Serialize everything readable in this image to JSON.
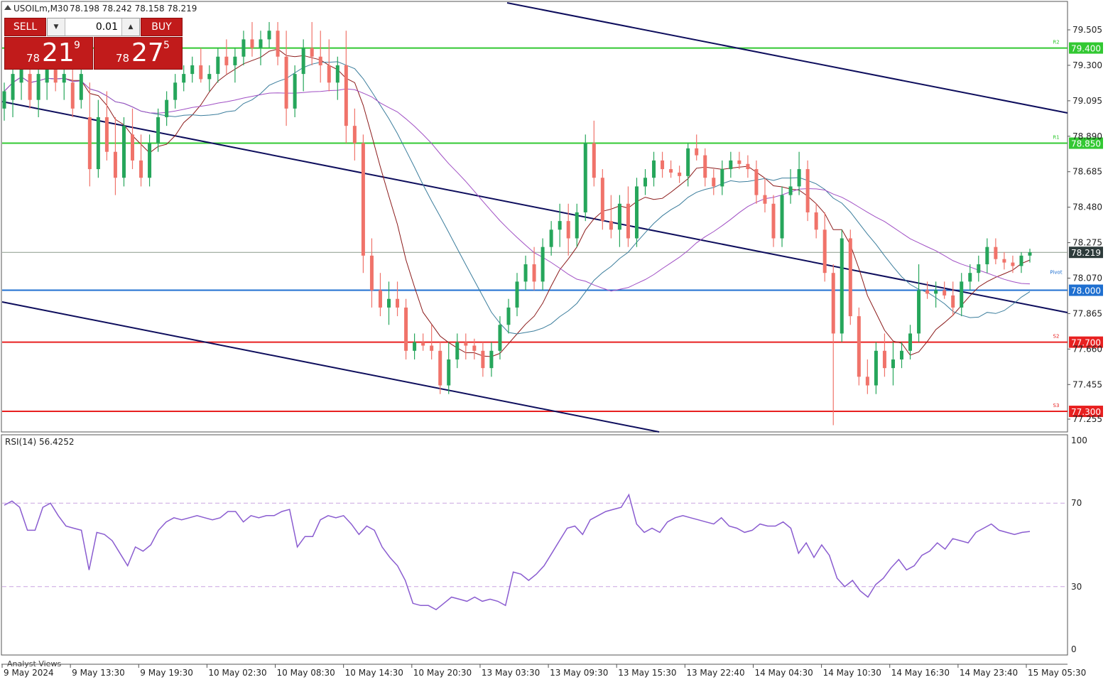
{
  "header": {
    "symbol_label": "USOILm,M30",
    "ohlc": "78.198 78.242 78.158 78.219",
    "collapse_icon": "triangle-up-icon"
  },
  "trade_panel": {
    "sell_label": "SELL",
    "buy_label": "BUY",
    "lot_value": "0.01",
    "sell_quote": {
      "prefix": "78",
      "big": "21",
      "sup": "9"
    },
    "buy_quote": {
      "prefix": "78",
      "big": "27",
      "sup": "5"
    }
  },
  "price_axis": {
    "ticks": [
      "79.505",
      "79.300",
      "79.095",
      "78.890",
      "78.685",
      "78.480",
      "78.275",
      "78.070",
      "77.865",
      "77.660",
      "77.455",
      "77.255"
    ],
    "current_price": "78.219"
  },
  "levels": [
    {
      "value": "79.400",
      "color": "#32c832",
      "tag": "R2"
    },
    {
      "value": "78.850",
      "color": "#32c832",
      "tag": "R1"
    },
    {
      "value": "78.000",
      "color": "#1e6fd0",
      "tag": "Pivot"
    },
    {
      "value": "77.700",
      "color": "#e82020",
      "tag": "S2"
    },
    {
      "value": "77.300",
      "color": "#e82020",
      "tag": "S3"
    }
  ],
  "rsi": {
    "label": "RSI(14) 56.4252",
    "ticks": [
      "100",
      "70",
      "30",
      "0"
    ]
  },
  "time_axis": [
    "9 May 2024",
    "9 May 13:30",
    "9 May 19:30",
    "10 May 02:30",
    "10 May 08:30",
    "10 May 14:30",
    "10 May 20:30",
    "13 May 03:30",
    "13 May 09:30",
    "13 May 15:30",
    "13 May 22:40",
    "14 May 04:30",
    "14 May 10:30",
    "14 May 16:30",
    "14 May 23:40",
    "15 May 05:30"
  ],
  "footer_label": "Analyst Views",
  "colors": {
    "bull": "#26a65b",
    "bear": "#f0736a",
    "ma_red": "#8b1a1a",
    "ma_teal": "#3b7d9c",
    "ma_purple": "#a04fc4",
    "channel": "#0d0d5c",
    "rsi": "#8a5cd0"
  },
  "chart_data": {
    "type": "candlestick",
    "symbol": "USOILm",
    "timeframe": "M30",
    "ylim": [
      77.2,
      79.62
    ],
    "candles": [
      {
        "o": 79.05,
        "h": 79.2,
        "l": 78.98,
        "c": 79.15
      },
      {
        "o": 79.1,
        "h": 79.3,
        "l": 79.0,
        "c": 79.25
      },
      {
        "o": 79.2,
        "h": 79.4,
        "l": 79.1,
        "c": 79.3
      },
      {
        "o": 79.25,
        "h": 79.35,
        "l": 79.05,
        "c": 79.1
      },
      {
        "o": 79.1,
        "h": 79.3,
        "l": 79.0,
        "c": 79.25
      },
      {
        "o": 79.2,
        "h": 79.35,
        "l": 79.1,
        "c": 79.3
      },
      {
        "o": 79.3,
        "h": 79.4,
        "l": 79.15,
        "c": 79.2
      },
      {
        "o": 79.2,
        "h": 79.3,
        "l": 79.1,
        "c": 79.25
      },
      {
        "o": 79.2,
        "h": 79.3,
        "l": 79.0,
        "c": 79.05
      },
      {
        "o": 79.1,
        "h": 79.3,
        "l": 79.05,
        "c": 79.25
      },
      {
        "o": 79.0,
        "h": 79.2,
        "l": 78.6,
        "c": 78.7
      },
      {
        "o": 78.7,
        "h": 79.1,
        "l": 78.65,
        "c": 79.0
      },
      {
        "o": 79.0,
        "h": 79.15,
        "l": 78.75,
        "c": 78.8
      },
      {
        "o": 78.8,
        "h": 79.0,
        "l": 78.55,
        "c": 78.65
      },
      {
        "o": 78.65,
        "h": 79.0,
        "l": 78.6,
        "c": 78.95
      },
      {
        "o": 78.9,
        "h": 79.05,
        "l": 78.7,
        "c": 78.75
      },
      {
        "o": 78.75,
        "h": 78.9,
        "l": 78.6,
        "c": 78.65
      },
      {
        "o": 78.65,
        "h": 78.9,
        "l": 78.6,
        "c": 78.85
      },
      {
        "o": 78.85,
        "h": 79.05,
        "l": 78.8,
        "c": 79.0
      },
      {
        "o": 79.0,
        "h": 79.15,
        "l": 78.95,
        "c": 79.1
      },
      {
        "o": 79.1,
        "h": 79.25,
        "l": 79.05,
        "c": 79.2
      },
      {
        "o": 79.2,
        "h": 79.3,
        "l": 79.15,
        "c": 79.25
      },
      {
        "o": 79.25,
        "h": 79.35,
        "l": 79.2,
        "c": 79.3
      },
      {
        "o": 79.3,
        "h": 79.4,
        "l": 79.2,
        "c": 79.22
      },
      {
        "o": 79.22,
        "h": 79.3,
        "l": 79.15,
        "c": 79.25
      },
      {
        "o": 79.25,
        "h": 79.4,
        "l": 79.2,
        "c": 79.35
      },
      {
        "o": 79.35,
        "h": 79.45,
        "l": 79.25,
        "c": 79.3
      },
      {
        "o": 79.3,
        "h": 79.4,
        "l": 79.2,
        "c": 79.35
      },
      {
        "o": 79.35,
        "h": 79.5,
        "l": 79.3,
        "c": 79.45
      },
      {
        "o": 79.45,
        "h": 79.55,
        "l": 79.35,
        "c": 79.4
      },
      {
        "o": 79.4,
        "h": 79.5,
        "l": 79.3,
        "c": 79.45
      },
      {
        "o": 79.45,
        "h": 79.55,
        "l": 79.4,
        "c": 79.5
      },
      {
        "o": 79.5,
        "h": 79.55,
        "l": 79.3,
        "c": 79.35
      },
      {
        "o": 79.35,
        "h": 79.5,
        "l": 78.95,
        "c": 79.05
      },
      {
        "o": 79.05,
        "h": 79.3,
        "l": 79.0,
        "c": 79.25
      },
      {
        "o": 79.25,
        "h": 79.45,
        "l": 79.15,
        "c": 79.4
      },
      {
        "o": 79.4,
        "h": 79.55,
        "l": 79.3,
        "c": 79.35
      },
      {
        "o": 79.35,
        "h": 79.5,
        "l": 79.2,
        "c": 79.3
      },
      {
        "o": 79.3,
        "h": 79.45,
        "l": 79.15,
        "c": 79.2
      },
      {
        "o": 79.2,
        "h": 79.35,
        "l": 79.1,
        "c": 79.3
      },
      {
        "o": 79.3,
        "h": 79.5,
        "l": 78.85,
        "c": 78.95
      },
      {
        "o": 78.95,
        "h": 79.05,
        "l": 78.75,
        "c": 78.85
      },
      {
        "o": 78.85,
        "h": 78.9,
        "l": 78.1,
        "c": 78.2
      },
      {
        "o": 78.2,
        "h": 78.3,
        "l": 77.9,
        "c": 78.0
      },
      {
        "o": 78.0,
        "h": 78.1,
        "l": 77.85,
        "c": 77.9
      },
      {
        "o": 77.9,
        "h": 78.05,
        "l": 77.8,
        "c": 77.95
      },
      {
        "o": 77.95,
        "h": 78.05,
        "l": 77.85,
        "c": 77.9
      },
      {
        "o": 77.9,
        "h": 77.95,
        "l": 77.6,
        "c": 77.65
      },
      {
        "o": 77.65,
        "h": 77.75,
        "l": 77.6,
        "c": 77.7
      },
      {
        "o": 77.7,
        "h": 77.75,
        "l": 77.65,
        "c": 77.68
      },
      {
        "o": 77.68,
        "h": 77.8,
        "l": 77.6,
        "c": 77.65
      },
      {
        "o": 77.65,
        "h": 77.7,
        "l": 77.4,
        "c": 77.45
      },
      {
        "o": 77.45,
        "h": 77.7,
        "l": 77.4,
        "c": 77.6
      },
      {
        "o": 77.6,
        "h": 77.75,
        "l": 77.55,
        "c": 77.7
      },
      {
        "o": 77.7,
        "h": 77.75,
        "l": 77.6,
        "c": 77.68
      },
      {
        "o": 77.68,
        "h": 77.72,
        "l": 77.6,
        "c": 77.65
      },
      {
        "o": 77.65,
        "h": 77.7,
        "l": 77.5,
        "c": 77.55
      },
      {
        "o": 77.55,
        "h": 77.7,
        "l": 77.5,
        "c": 77.65
      },
      {
        "o": 77.65,
        "h": 77.85,
        "l": 77.6,
        "c": 77.8
      },
      {
        "o": 77.8,
        "h": 77.95,
        "l": 77.75,
        "c": 77.9
      },
      {
        "o": 77.9,
        "h": 78.1,
        "l": 77.85,
        "c": 78.05
      },
      {
        "o": 78.05,
        "h": 78.2,
        "l": 78.0,
        "c": 78.15
      },
      {
        "o": 78.15,
        "h": 78.25,
        "l": 78.0,
        "c": 78.05
      },
      {
        "o": 78.05,
        "h": 78.3,
        "l": 78.0,
        "c": 78.25
      },
      {
        "o": 78.25,
        "h": 78.4,
        "l": 78.2,
        "c": 78.35
      },
      {
        "o": 78.35,
        "h": 78.5,
        "l": 78.25,
        "c": 78.4
      },
      {
        "o": 78.4,
        "h": 78.5,
        "l": 78.2,
        "c": 78.3
      },
      {
        "o": 78.3,
        "h": 78.5,
        "l": 78.25,
        "c": 78.45
      },
      {
        "o": 78.45,
        "h": 78.9,
        "l": 78.4,
        "c": 78.85
      },
      {
        "o": 78.85,
        "h": 78.98,
        "l": 78.6,
        "c": 78.65
      },
      {
        "o": 78.65,
        "h": 78.7,
        "l": 78.35,
        "c": 78.4
      },
      {
        "o": 78.4,
        "h": 78.55,
        "l": 78.3,
        "c": 78.35
      },
      {
        "o": 78.35,
        "h": 78.55,
        "l": 78.25,
        "c": 78.5
      },
      {
        "o": 78.5,
        "h": 78.6,
        "l": 78.25,
        "c": 78.3
      },
      {
        "o": 78.3,
        "h": 78.65,
        "l": 78.25,
        "c": 78.6
      },
      {
        "o": 78.6,
        "h": 78.7,
        "l": 78.55,
        "c": 78.65
      },
      {
        "o": 78.65,
        "h": 78.8,
        "l": 78.6,
        "c": 78.75
      },
      {
        "o": 78.75,
        "h": 78.8,
        "l": 78.65,
        "c": 78.7
      },
      {
        "o": 78.7,
        "h": 78.75,
        "l": 78.65,
        "c": 78.68
      },
      {
        "o": 78.68,
        "h": 78.72,
        "l": 78.62,
        "c": 78.66
      },
      {
        "o": 78.66,
        "h": 78.85,
        "l": 78.6,
        "c": 78.82
      },
      {
        "o": 78.82,
        "h": 78.9,
        "l": 78.75,
        "c": 78.78
      },
      {
        "o": 78.78,
        "h": 78.82,
        "l": 78.6,
        "c": 78.65
      },
      {
        "o": 78.65,
        "h": 78.7,
        "l": 78.55,
        "c": 78.6
      },
      {
        "o": 78.6,
        "h": 78.75,
        "l": 78.55,
        "c": 78.7
      },
      {
        "o": 78.7,
        "h": 78.8,
        "l": 78.65,
        "c": 78.75
      },
      {
        "o": 78.75,
        "h": 78.8,
        "l": 78.7,
        "c": 78.73
      },
      {
        "o": 78.73,
        "h": 78.78,
        "l": 78.65,
        "c": 78.7
      },
      {
        "o": 78.7,
        "h": 78.75,
        "l": 78.5,
        "c": 78.55
      },
      {
        "o": 78.55,
        "h": 78.65,
        "l": 78.45,
        "c": 78.5
      },
      {
        "o": 78.5,
        "h": 78.55,
        "l": 78.25,
        "c": 78.3
      },
      {
        "o": 78.3,
        "h": 78.6,
        "l": 78.25,
        "c": 78.55
      },
      {
        "o": 78.55,
        "h": 78.7,
        "l": 78.5,
        "c": 78.6
      },
      {
        "o": 78.6,
        "h": 78.8,
        "l": 78.55,
        "c": 78.7
      },
      {
        "o": 78.7,
        "h": 78.75,
        "l": 78.4,
        "c": 78.45
      },
      {
        "o": 78.45,
        "h": 78.5,
        "l": 78.3,
        "c": 78.35
      },
      {
        "o": 78.35,
        "h": 78.45,
        "l": 78.05,
        "c": 78.1
      },
      {
        "o": 78.1,
        "h": 78.15,
        "l": 77.22,
        "c": 77.75
      },
      {
        "o": 77.75,
        "h": 78.35,
        "l": 77.7,
        "c": 78.3
      },
      {
        "o": 78.3,
        "h": 78.35,
        "l": 77.8,
        "c": 77.85
      },
      {
        "o": 77.85,
        "h": 77.9,
        "l": 77.45,
        "c": 77.5
      },
      {
        "o": 77.5,
        "h": 77.6,
        "l": 77.4,
        "c": 77.45
      },
      {
        "o": 77.45,
        "h": 77.7,
        "l": 77.4,
        "c": 77.65
      },
      {
        "o": 77.65,
        "h": 77.75,
        "l": 77.5,
        "c": 77.55
      },
      {
        "o": 77.55,
        "h": 77.7,
        "l": 77.45,
        "c": 77.6
      },
      {
        "o": 77.6,
        "h": 77.7,
        "l": 77.55,
        "c": 77.65
      },
      {
        "o": 77.65,
        "h": 77.8,
        "l": 77.6,
        "c": 77.75
      },
      {
        "o": 77.75,
        "h": 78.15,
        "l": 77.7,
        "c": 78.0
      },
      {
        "o": 78.0,
        "h": 78.05,
        "l": 77.95,
        "c": 77.98
      },
      {
        "o": 77.98,
        "h": 78.05,
        "l": 77.9,
        "c": 78.0
      },
      {
        "o": 78.0,
        "h": 78.05,
        "l": 77.95,
        "c": 77.97
      },
      {
        "o": 77.97,
        "h": 78.05,
        "l": 77.85,
        "c": 77.9
      },
      {
        "o": 77.9,
        "h": 78.1,
        "l": 77.85,
        "c": 78.05
      },
      {
        "o": 78.05,
        "h": 78.15,
        "l": 78.0,
        "c": 78.1
      },
      {
        "o": 78.1,
        "h": 78.2,
        "l": 78.05,
        "c": 78.15
      },
      {
        "o": 78.15,
        "h": 78.3,
        "l": 78.1,
        "c": 78.25
      },
      {
        "o": 78.25,
        "h": 78.3,
        "l": 78.15,
        "c": 78.18
      },
      {
        "o": 78.18,
        "h": 78.22,
        "l": 78.12,
        "c": 78.16
      },
      {
        "o": 78.16,
        "h": 78.2,
        "l": 78.1,
        "c": 78.14
      },
      {
        "o": 78.14,
        "h": 78.22,
        "l": 78.1,
        "c": 78.2
      },
      {
        "o": 78.2,
        "h": 78.24,
        "l": 78.16,
        "c": 78.219
      }
    ],
    "rsi": [
      69,
      71,
      68,
      57,
      57,
      68,
      70,
      64,
      59,
      58,
      57,
      38,
      56,
      55,
      52,
      46,
      40,
      49,
      47,
      50,
      57,
      61,
      63,
      62,
      63,
      64,
      63,
      62,
      63,
      66,
      66,
      61,
      64,
      63,
      64,
      64,
      66,
      67,
      49,
      54,
      54,
      62,
      64,
      63,
      64,
      60,
      55,
      59,
      57,
      49,
      44,
      40,
      33,
      22,
      21,
      21,
      19,
      22,
      25,
      24,
      23,
      25,
      23,
      24,
      23,
      21,
      37,
      36,
      33,
      36,
      40,
      46,
      52,
      58,
      59,
      55,
      62,
      64,
      66,
      67,
      68,
      74,
      60,
      56,
      58,
      56,
      61,
      63,
      64,
      63,
      62,
      61,
      60,
      63,
      59,
      58,
      56,
      57,
      60,
      59,
      59,
      61,
      58,
      46,
      51,
      44,
      50,
      45,
      34,
      30,
      33,
      28,
      25,
      31,
      34,
      39,
      43,
      38,
      40,
      45,
      47,
      51,
      48,
      53,
      52,
      51,
      56,
      58,
      60,
      57,
      56,
      55,
      56,
      56.4252
    ],
    "moving_averages": [
      {
        "color": "#8b1a1a"
      },
      {
        "color": "#3b7d9c"
      },
      {
        "color": "#a04fc4"
      }
    ]
  }
}
